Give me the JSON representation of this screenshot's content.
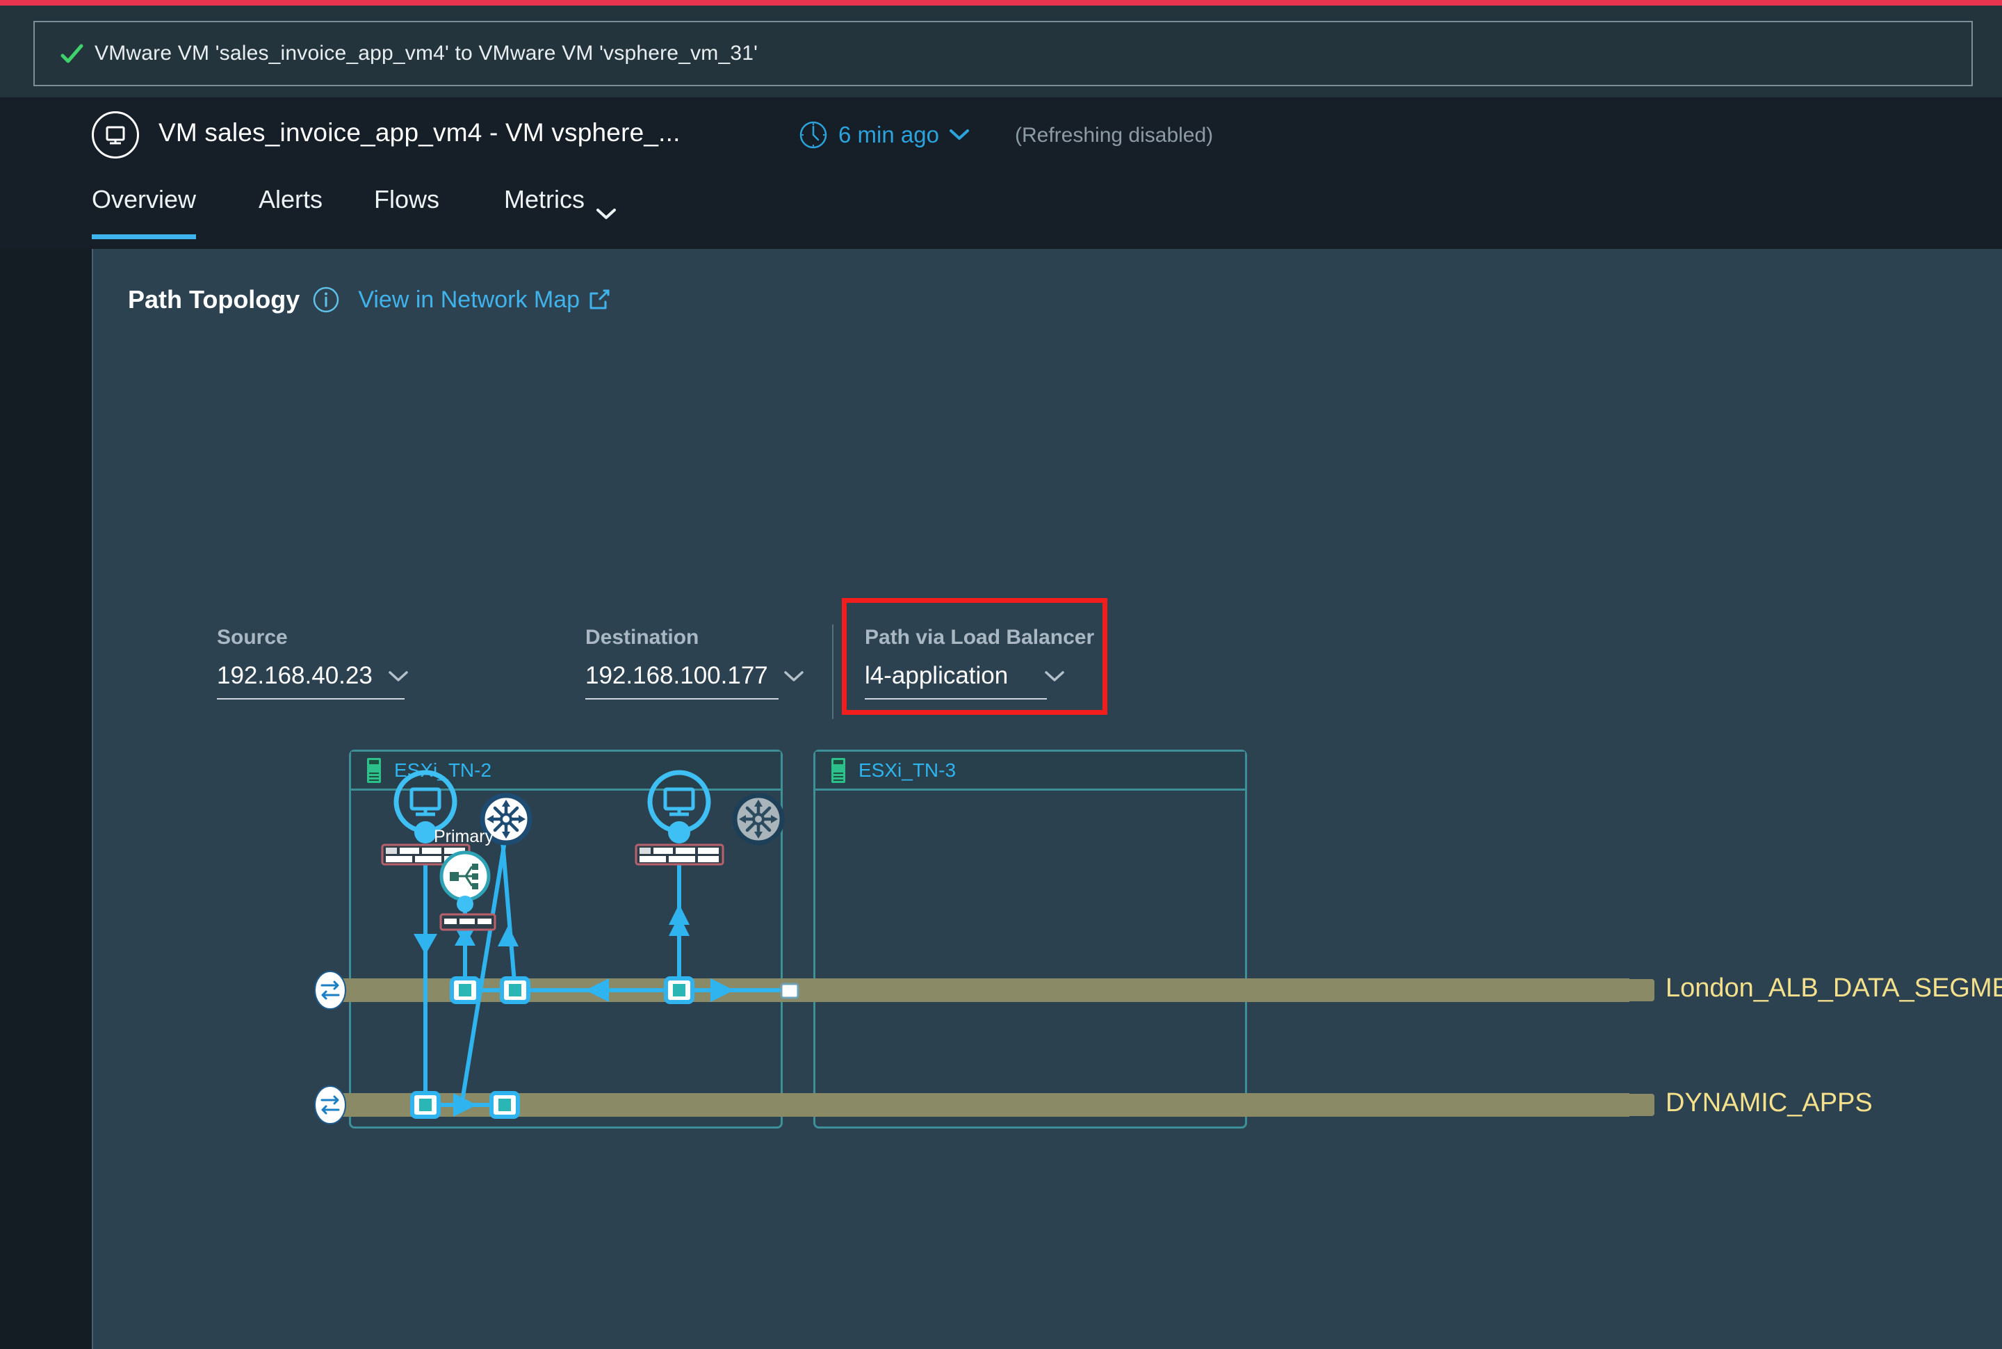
{
  "banner": {
    "icon": "check-icon",
    "message": "VMware VM 'sales_invoice_app_vm4' to VMware VM 'vsphere_vm_31'"
  },
  "header": {
    "icon": "vm-monitor-icon",
    "title": "VM sales_invoice_app_vm4 - VM vsphere_...",
    "refresh_icon": "clock-icon",
    "refresh_label": "6 min ago",
    "refresh_chevron": "chevron-down-icon",
    "refresh_note": "(Refreshing  disabled)"
  },
  "tabs": [
    {
      "label": "Overview",
      "active": true
    },
    {
      "label": "Alerts",
      "active": false
    },
    {
      "label": "Flows",
      "active": false
    },
    {
      "label": "Metrics",
      "active": false,
      "chevron": "chevron-down-icon"
    }
  ],
  "card": {
    "title": "Path Topology",
    "info_icon": "info-icon",
    "network_map_link": "View in Network Map",
    "external_icon": "external-link-icon"
  },
  "controls": {
    "source": {
      "label": "Source",
      "value": "192.168.40.23",
      "chevron": "chevron-down-icon"
    },
    "direction": {
      "left_icon": "arrow-left-icon",
      "right_icon": "arrow-right-icon",
      "selected": "right"
    },
    "destination": {
      "label": "Destination",
      "value": "192.168.100.177",
      "chevron": "chevron-down-icon"
    },
    "load_balancer": {
      "label": "Path via Load Balancer",
      "value": "l4-application",
      "chevron": "chevron-down-icon",
      "highlight_color": "#f21d1d"
    }
  },
  "topology": {
    "hosts": [
      {
        "name": "ESXi_TN-2",
        "icon": "server-icon"
      },
      {
        "name": "ESXi_TN-3",
        "icon": "server-icon"
      }
    ],
    "nodes": [
      {
        "id": "vm-left",
        "type": "vm-icon",
        "label": "",
        "state": "active"
      },
      {
        "id": "router-left",
        "type": "router-icon",
        "label": "",
        "state": "active"
      },
      {
        "id": "lb-primary",
        "type": "load-balancer-icon",
        "label": "Primary",
        "state": "active"
      },
      {
        "id": "vm-right",
        "type": "vm-icon",
        "label": "",
        "state": "active"
      },
      {
        "id": "router-right",
        "type": "router-icon",
        "label": "",
        "state": "inactive"
      }
    ],
    "segments": [
      {
        "name": "London_ALB_DATA_SEGMENT",
        "icon": "segment-icon",
        "color": "#8a8a66"
      },
      {
        "name": "DYNAMIC_APPS",
        "icon": "segment-icon",
        "color": "#8a8a66"
      }
    ]
  },
  "colors": {
    "accent_blue": "#3fc0f5",
    "link_blue": "#40b3ec",
    "segment_olive": "#8a8a66",
    "segment_label": "#f5e08c",
    "alert_red": "#f21d1d",
    "host_border": "#3d8f98",
    "top_strip": "#e8344e"
  }
}
